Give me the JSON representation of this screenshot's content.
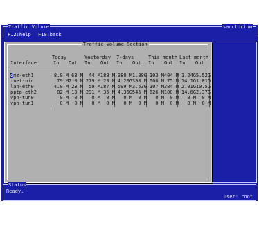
{
  "header": {
    "title": "Traffic Volume",
    "host": "sanctorium",
    "keys": [
      "F12:help",
      "F10:back"
    ]
  },
  "section": {
    "title": "Traffic Volume Section",
    "group_headers": [
      "Today",
      "Yesterday",
      "7-days",
      "This month",
      "Last month"
    ],
    "sub_headers": [
      "Interface",
      "In",
      "Out",
      "In",
      "Out",
      "In",
      "Out",
      "In",
      "Out",
      "In",
      "Out"
    ],
    "rows": [
      [
        "dmz-eth1",
        "8.0 M",
        "63 M",
        "44 M",
        "188 M",
        "380 M",
        "1.38G",
        "103 M",
        "404 M",
        "1.24G",
        "5.52G"
      ],
      [
        "inet-nic",
        "79 M",
        "7.0 M",
        "279 M",
        "23 M",
        "4.20G",
        "398 M",
        "600 M",
        "75 M",
        "14.1G",
        "1.81G"
      ],
      [
        "lan-eth0",
        "4.0 M",
        "23 M",
        "59 M",
        "187 M",
        "599 M",
        "3.53G",
        "107 M",
        "384 M",
        "2.01G",
        "10.5G"
      ],
      [
        "pptp-eth2",
        "82 M",
        "10 M",
        "291 M",
        "35 M",
        "4.35G",
        "545 M",
        "626 M",
        "100 M",
        "14.6G",
        "2.37G"
      ],
      [
        "vpn-tun0",
        "0 M",
        "0 M",
        "0 M",
        "0 M",
        "0 M",
        "0 M",
        "0 M",
        "0 M",
        "0 M",
        "0 M"
      ],
      [
        "vpn-tun1",
        "0 M",
        "0 M",
        "0 M",
        "0 M",
        "0 M",
        "0 M",
        "0 M",
        "0 M",
        "0 M",
        "0 M"
      ]
    ]
  },
  "status": {
    "label": "Status",
    "text": "Ready.",
    "user": "user: root"
  }
}
